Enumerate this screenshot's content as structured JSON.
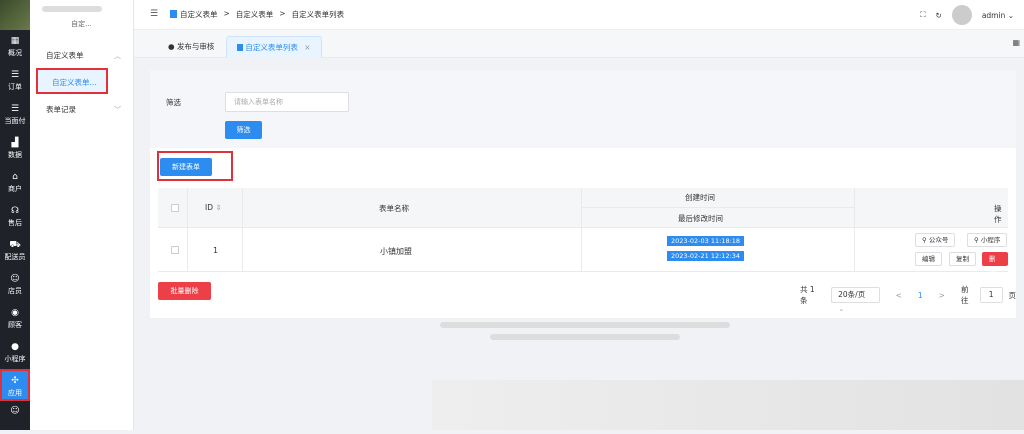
{
  "sidebar": {
    "items": [
      {
        "label": "概况",
        "icon": "dashboard-icon",
        "glyph": "▦"
      },
      {
        "label": "订单",
        "icon": "list-icon",
        "glyph": "☰"
      },
      {
        "label": "当面付",
        "icon": "list-icon",
        "glyph": "☰"
      },
      {
        "label": "数据",
        "icon": "chart-icon",
        "glyph": "▟"
      },
      {
        "label": "商户",
        "icon": "store-icon",
        "glyph": "⌂"
      },
      {
        "label": "售后",
        "icon": "headset-icon",
        "glyph": "☊"
      },
      {
        "label": "配送员",
        "icon": "truck-icon",
        "glyph": "⛟"
      },
      {
        "label": "店员",
        "icon": "user-icon",
        "glyph": "☺"
      },
      {
        "label": "顾客",
        "icon": "customer-icon",
        "glyph": "◉"
      },
      {
        "label": "小程序",
        "icon": "chat-icon",
        "glyph": "●"
      },
      {
        "label": "应用",
        "icon": "apps-icon",
        "glyph": "✣"
      },
      {
        "label": "",
        "icon": "user-icon",
        "glyph": "☺"
      }
    ]
  },
  "subnav": {
    "brand": "自定...",
    "group1": "自定义表单",
    "group1_item": "自定义表单...",
    "group2": "表单记录"
  },
  "topbar": {
    "breadcrumb": [
      "自定义表单",
      ">",
      "自定义表单",
      ">",
      "自定义表单列表"
    ],
    "user": "admin"
  },
  "tabs": [
    {
      "label": "发布与审核"
    },
    {
      "label": "自定义表单列表",
      "close": "×"
    }
  ],
  "filter": {
    "label": "筛选",
    "placeholder": "请输入表单名称",
    "button": "筛选"
  },
  "new_button": "新建表单",
  "table": {
    "headers": {
      "id": "ID",
      "name": "表单名称",
      "created": "创建时间",
      "modified": "最后修改时间",
      "actions": "操作"
    },
    "rows": [
      {
        "id": "1",
        "name": "小镇加盟",
        "created": "2023-02-03 11:18:18",
        "modified": "2023-02-21 12:12:34",
        "actions": [
          "公众号",
          "小程序",
          "编辑",
          "复制",
          "删除"
        ]
      }
    ]
  },
  "batch_delete": "批量删除",
  "pagination": {
    "total": "共 1 条",
    "per_page": "20条/页",
    "prev": "<",
    "page": "1",
    "next": ">",
    "goto": "前往",
    "goto_value": "1",
    "page_suffix": "页"
  },
  "colors": {
    "primary": "#2d8cf0",
    "danger": "#ed3f47",
    "sidebar": "#20222a"
  }
}
